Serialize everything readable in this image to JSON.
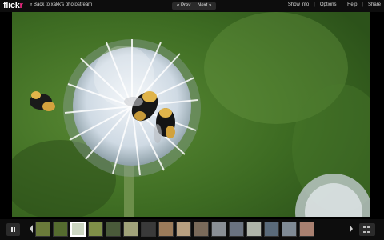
{
  "header": {
    "logo_main": "flick",
    "logo_accent": "r",
    "back_label": "« Back to xakk's photostream",
    "prev_label": "« Prev",
    "next_label": "Next »",
    "links": [
      "Show info",
      "Options",
      "Help",
      "Share"
    ],
    "separator": "|"
  },
  "photo": {
    "subject": "globe thistle flower with bumblebees",
    "colors": {
      "background": "#4a7a2a",
      "flower": "#dfe8ef",
      "bee": "#e0b44a"
    }
  },
  "filmstrip": {
    "selected_index": 2,
    "thumb_colors": [
      "#6b7a3a",
      "#556b2f",
      "#cdd7c2",
      "#7f8f48",
      "#4a5a3a",
      "#a0a27a",
      "#3a3a3a",
      "#9b7b5a",
      "#b8a080",
      "#7a6a5a",
      "#8a8f95",
      "#6b7380",
      "#b0b5aa",
      "#5a6a7a",
      "#7f8a95",
      "#a88070"
    ]
  }
}
